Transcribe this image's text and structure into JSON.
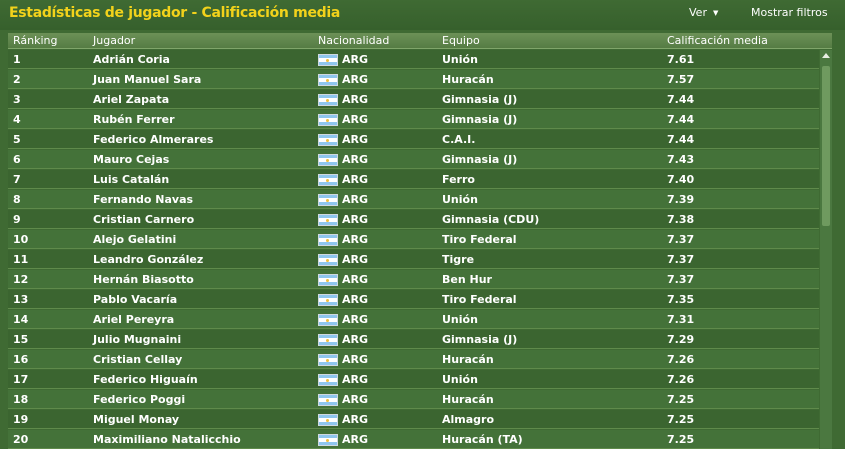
{
  "header": {
    "title": "Estadísticas de jugador - Calificación media",
    "ver_label": "Ver",
    "filters_label": "Mostrar filtros"
  },
  "columns": {
    "rank": "Ránking",
    "player": "Jugador",
    "nationality": "Nacionalidad",
    "team": "Equipo",
    "rating": "Calificación media"
  },
  "icons": {
    "flag": "argentina-flag-icon",
    "dropdown": "chevron-down-icon",
    "scroll_up": "arrow-up-icon"
  },
  "colors": {
    "title": "#f2d21b",
    "background": "#3f6a33"
  },
  "rows": [
    {
      "rank": "1",
      "player": "Adrián Coria",
      "nat": "ARG",
      "team": "Unión",
      "rating": "7.61"
    },
    {
      "rank": "2",
      "player": "Juan Manuel Sara",
      "nat": "ARG",
      "team": "Huracán",
      "rating": "7.57"
    },
    {
      "rank": "3",
      "player": "Ariel Zapata",
      "nat": "ARG",
      "team": "Gimnasia (J)",
      "rating": "7.44"
    },
    {
      "rank": "4",
      "player": "Rubén Ferrer",
      "nat": "ARG",
      "team": "Gimnasia (J)",
      "rating": "7.44"
    },
    {
      "rank": "5",
      "player": "Federico Almerares",
      "nat": "ARG",
      "team": "C.A.I.",
      "rating": "7.44"
    },
    {
      "rank": "6",
      "player": "Mauro Cejas",
      "nat": "ARG",
      "team": "Gimnasia (J)",
      "rating": "7.43"
    },
    {
      "rank": "7",
      "player": "Luis Catalán",
      "nat": "ARG",
      "team": "Ferro",
      "rating": "7.40"
    },
    {
      "rank": "8",
      "player": "Fernando Navas",
      "nat": "ARG",
      "team": "Unión",
      "rating": "7.39"
    },
    {
      "rank": "9",
      "player": "Cristian Carnero",
      "nat": "ARG",
      "team": "Gimnasia (CDU)",
      "rating": "7.38"
    },
    {
      "rank": "10",
      "player": "Alejo Gelatini",
      "nat": "ARG",
      "team": "Tiro Federal",
      "rating": "7.37"
    },
    {
      "rank": "11",
      "player": "Leandro González",
      "nat": "ARG",
      "team": "Tigre",
      "rating": "7.37"
    },
    {
      "rank": "12",
      "player": "Hernán Biasotto",
      "nat": "ARG",
      "team": "Ben Hur",
      "rating": "7.37"
    },
    {
      "rank": "13",
      "player": "Pablo Vacaría",
      "nat": "ARG",
      "team": "Tiro Federal",
      "rating": "7.35"
    },
    {
      "rank": "14",
      "player": "Ariel Pereyra",
      "nat": "ARG",
      "team": "Unión",
      "rating": "7.31"
    },
    {
      "rank": "15",
      "player": "Julio Mugnaini",
      "nat": "ARG",
      "team": "Gimnasia (J)",
      "rating": "7.29"
    },
    {
      "rank": "16",
      "player": "Cristian Cellay",
      "nat": "ARG",
      "team": "Huracán",
      "rating": "7.26"
    },
    {
      "rank": "17",
      "player": "Federico Higuaín",
      "nat": "ARG",
      "team": "Unión",
      "rating": "7.26"
    },
    {
      "rank": "18",
      "player": "Federico Poggi",
      "nat": "ARG",
      "team": "Huracán",
      "rating": "7.25"
    },
    {
      "rank": "19",
      "player": "Miguel Monay",
      "nat": "ARG",
      "team": "Almagro",
      "rating": "7.25"
    },
    {
      "rank": "20",
      "player": "Maximiliano Natalicchio",
      "nat": "ARG",
      "team": "Huracán (TA)",
      "rating": "7.25"
    }
  ]
}
